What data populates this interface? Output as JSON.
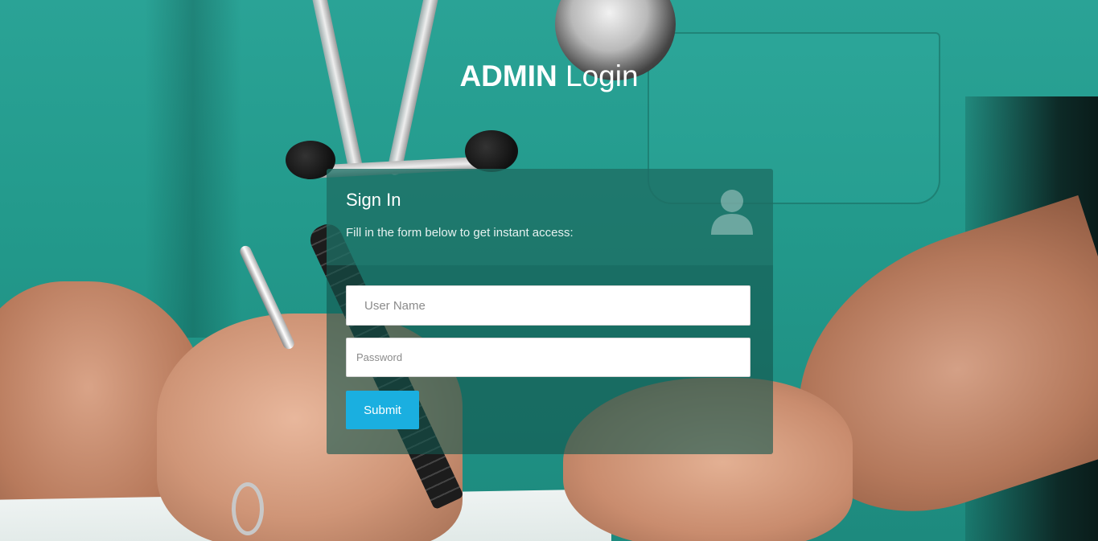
{
  "header": {
    "title_strong": "ADMIN",
    "title_light": "Login"
  },
  "panel": {
    "title": "Sign In",
    "subtitle": "Fill in the form below to get instant access:",
    "icon": "user-icon"
  },
  "form": {
    "username_placeholder": "User Name",
    "username_value": "",
    "password_placeholder": "Password",
    "password_value": "",
    "submit_label": "Submit"
  },
  "colors": {
    "accent": "#1aafe0",
    "panel_head": "#1e6e64",
    "panel_body": "#14554e",
    "scrubs": "#2aa396"
  }
}
